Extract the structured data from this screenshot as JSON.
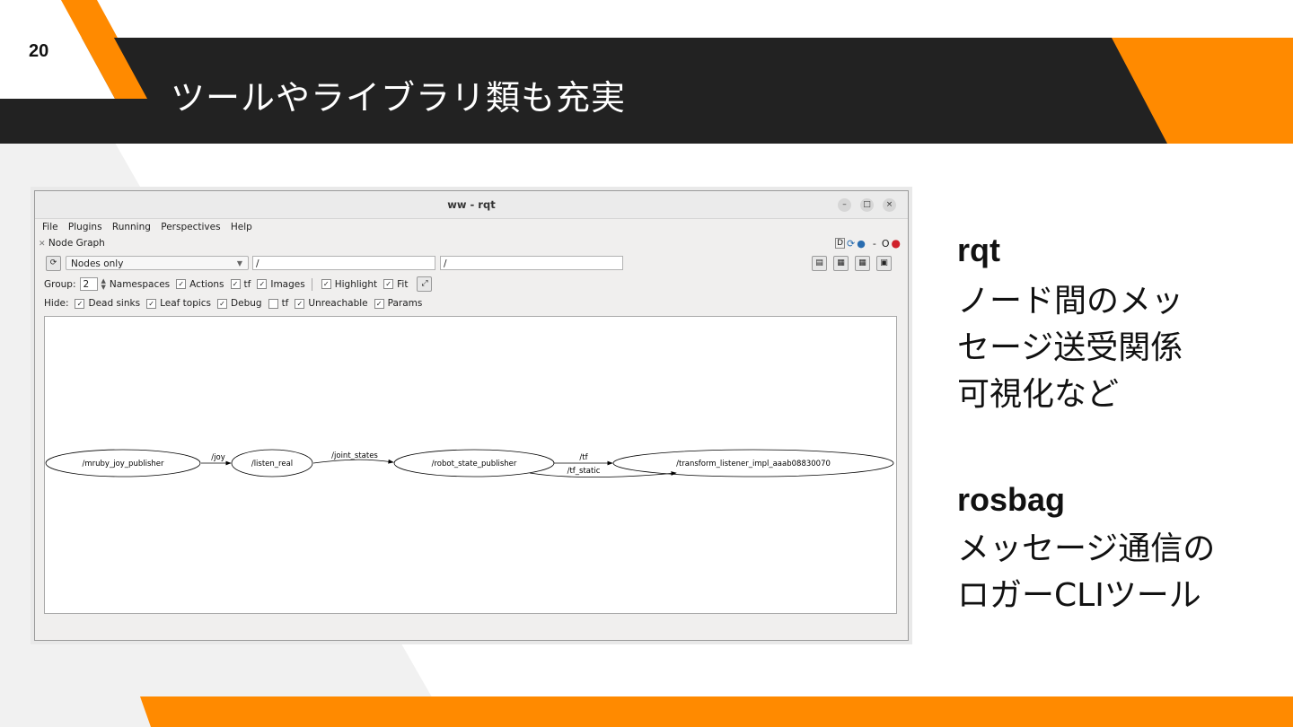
{
  "slide": {
    "page_number": "20",
    "title": "ツールやライブラリ類も充実",
    "colors": {
      "dark": "#222222",
      "accent": "#ff8a00",
      "light_panel": "#f1f1f1"
    }
  },
  "window": {
    "title": "ww - rqt",
    "controls": {
      "minimize": "–",
      "maximize": "□",
      "close": "×"
    },
    "menu": [
      "File",
      "Plugins",
      "Running",
      "Perspectives",
      "Help"
    ],
    "plugin_title": "Node Graph",
    "plugin_buttons": {
      "d": "D",
      "dash": "-",
      "o": "O"
    },
    "filter_combo": "Nodes only",
    "namespace_filter": "/",
    "topic_filter": "/",
    "group_label": "Group:",
    "group_value": "2",
    "options": [
      "Namespaces",
      "Actions",
      "tf",
      "Images",
      "Highlight",
      "Fit"
    ],
    "hide_label": "Hide:",
    "hide_options": [
      {
        "label": "Dead sinks",
        "checked": true
      },
      {
        "label": "Leaf topics",
        "checked": true
      },
      {
        "label": "Debug",
        "checked": true
      },
      {
        "label": "tf",
        "checked": false
      },
      {
        "label": "Unreachable",
        "checked": true
      },
      {
        "label": "Params",
        "checked": true
      }
    ],
    "graph": {
      "nodes": [
        "/mruby_joy_publisher",
        "/listen_real",
        "/robot_state_publisher",
        "/transform_listener_impl_aaab08830070"
      ],
      "edges": [
        "/joy",
        "/joint_states",
        "/tf",
        "/tf_static"
      ]
    }
  },
  "side": {
    "rqt_heading": "rqt",
    "rqt_lines": [
      "ノード間のメッ",
      "セージ送受関係",
      "可視化など"
    ],
    "rosbag_heading": "rosbag",
    "rosbag_lines": [
      "メッセージ通信の",
      "ロガーCLIツール"
    ]
  }
}
